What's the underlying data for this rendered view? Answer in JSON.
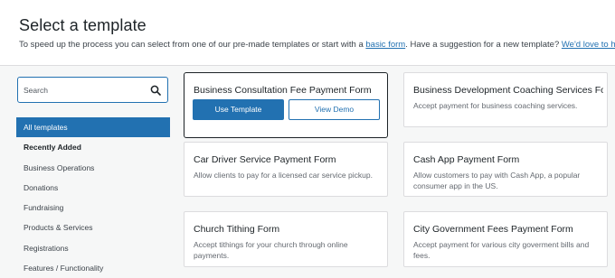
{
  "header": {
    "title": "Select a template",
    "subtitle_before": "To speed up the process you can select from one of our pre-made templates or start with a ",
    "basic_form_link": "basic form",
    "subtitle_middle": ". Have a suggestion for a new template? ",
    "suggestion_link": "We'd love to hear it"
  },
  "search": {
    "placeholder": "Search",
    "icon": "search-icon"
  },
  "categories": [
    {
      "label": "All templates",
      "state": "active"
    },
    {
      "label": "Recently Added",
      "state": "bold"
    },
    {
      "label": "Business Operations"
    },
    {
      "label": "Donations"
    },
    {
      "label": "Fundraising"
    },
    {
      "label": "Products & Services"
    },
    {
      "label": "Registrations"
    },
    {
      "label": "Features / Functionality"
    }
  ],
  "templates": [
    {
      "title": "Business Consultation Fee Payment Form",
      "use_label": "Use Template",
      "demo_label": "View Demo",
      "selected": true
    },
    {
      "title": "Business Development Coaching Services Fo...",
      "description": "Accept payment for business coaching services."
    },
    {
      "title": "Car Driver Service Payment Form",
      "description": "Allow clients to pay for a licensed car service pickup."
    },
    {
      "title": "Cash App Payment Form",
      "description": "Allow customers to pay with Cash App, a popular consumer app in the US."
    },
    {
      "title": "Church Tithing Form",
      "description": "Accept tithings for your church through online payments."
    },
    {
      "title": "City Government Fees Payment Form",
      "description": "Accept payment for various city goverment bills and fees."
    }
  ],
  "colors": {
    "accent": "#2271b1",
    "background": "#f6f7f7",
    "selected_border": "#1d2327"
  }
}
